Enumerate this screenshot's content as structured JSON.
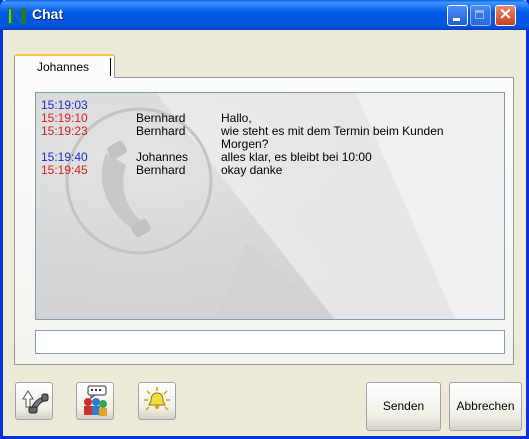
{
  "window": {
    "title": "Chat"
  },
  "tabs": [
    {
      "label": "Johannes"
    }
  ],
  "messages": [
    {
      "time": "15:19:03",
      "sender": "",
      "text": "",
      "color": "#1b2ed0"
    },
    {
      "time": "15:19:10",
      "sender": "Bernhard",
      "text": "Hallo,",
      "color": "#d42222"
    },
    {
      "time": "15:19:23",
      "sender": "Bernhard",
      "text": "wie steht es mit dem Termin beim Kunden Morgen?",
      "color": "#d42222"
    },
    {
      "time": "15:19:40",
      "sender": "Johannes",
      "text": "alles klar, es bleibt bei 10:00",
      "color": "#1b2ed0"
    },
    {
      "time": "15:19:45",
      "sender": "Bernhard",
      "text": "okay danke",
      "color": "#d42222"
    }
  ],
  "input": {
    "value": "",
    "placeholder": ""
  },
  "toolbar": {
    "icons": [
      "phone-icon",
      "users-icon",
      "alarm-bell-icon"
    ],
    "send_label": "Senden",
    "cancel_label": "Abbrechen"
  },
  "colors": {
    "titlebar": "#0358e6",
    "self_time": "#1b2ed0",
    "other_time": "#d42222"
  }
}
